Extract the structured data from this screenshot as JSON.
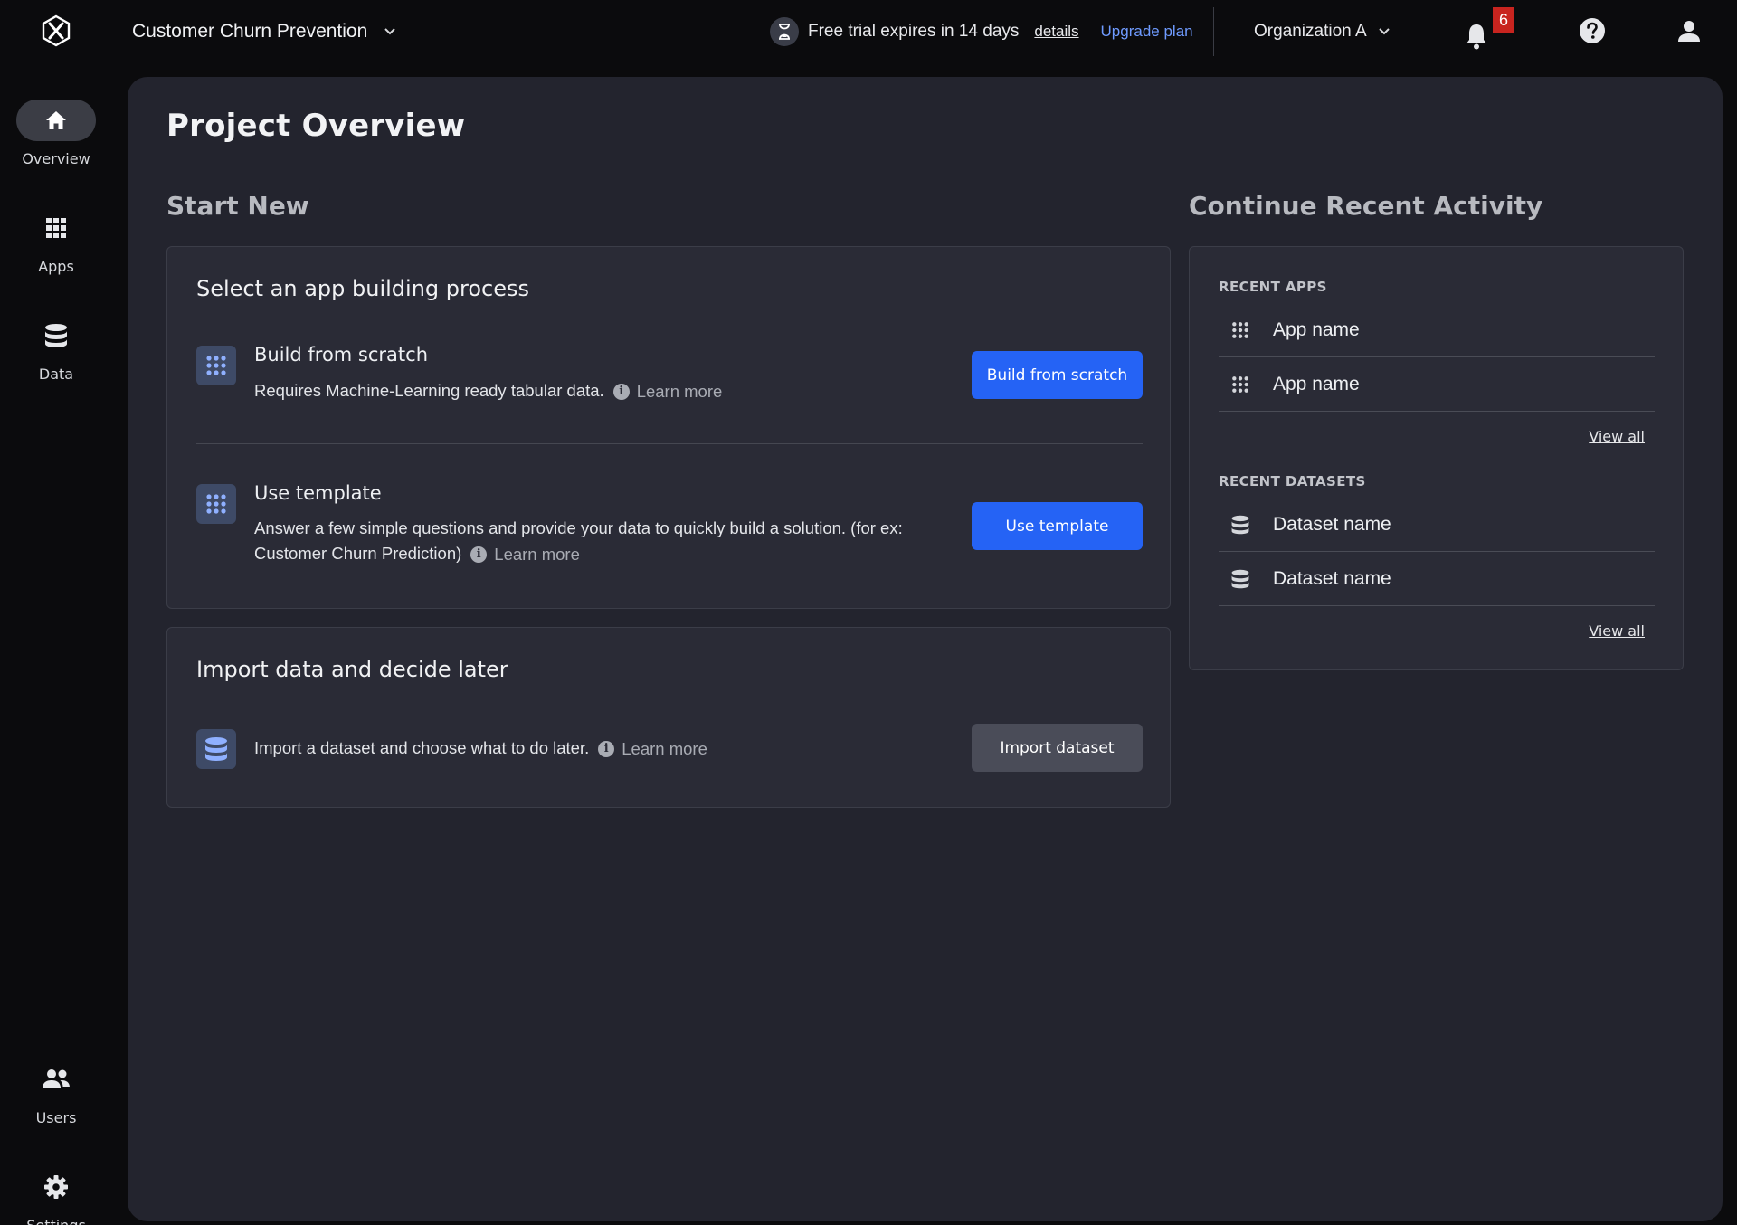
{
  "header": {
    "project_name": "Customer Churn Prevention",
    "trial_text": "Free trial expires in 14 days",
    "details_label": "details",
    "upgrade_label": "Upgrade plan",
    "org_name": "Organization A",
    "notification_count": "6"
  },
  "sidebar": {
    "items": [
      {
        "label": "Overview",
        "icon": "home-icon",
        "active": true
      },
      {
        "label": "Apps",
        "icon": "grid-icon"
      },
      {
        "label": "Data",
        "icon": "database-icon"
      },
      {
        "label": "Users",
        "icon": "users-icon"
      },
      {
        "label": "Settings",
        "icon": "gear-icon"
      }
    ]
  },
  "main": {
    "title": "Project Overview",
    "start_new": {
      "section_title": "Start New",
      "process_card": {
        "title": "Select an app building process",
        "options": [
          {
            "title": "Build from scratch",
            "description": "Requires Machine-Learning ready tabular data.",
            "learn_more": "Learn more",
            "button": "Build from scratch"
          },
          {
            "title": "Use template",
            "description_line1": "Answer a few simple questions and provide your data to quickly build a solution. (for ex:",
            "description_line2": "Customer Churn Prediction)",
            "learn_more": "Learn more",
            "button": "Use template"
          }
        ]
      },
      "import_card": {
        "title": "Import data and decide later",
        "description": "Import a dataset and choose what to do later.",
        "learn_more": "Learn more",
        "button": "Import dataset"
      }
    },
    "recent": {
      "section_title": "Continue Recent Activity",
      "apps_label": "RECENT APPS",
      "apps": [
        "App name",
        "App name"
      ],
      "apps_view_all": "View all",
      "datasets_label": "RECENT DATASETS",
      "datasets": [
        "Dataset name",
        "Dataset name"
      ],
      "datasets_view_all": "View all"
    }
  },
  "colors": {
    "accent": "#2563f5",
    "link": "#6f9bff",
    "badge": "#c8241f",
    "panel": "#23242e",
    "card": "#2a2b36"
  }
}
